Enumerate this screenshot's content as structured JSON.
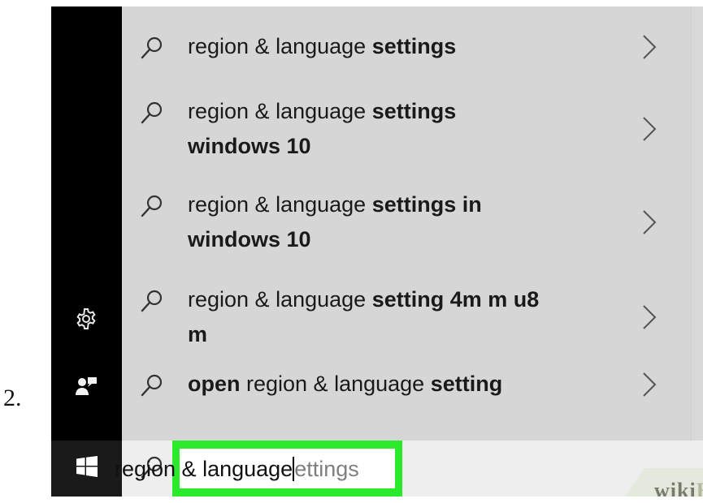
{
  "step_label": "2.",
  "sidebar": {
    "icons": [
      "gear-icon",
      "feedback-icon"
    ],
    "start_icon": "windows-start-icon"
  },
  "suggestions": [
    {
      "lines": [
        [
          {
            "t": "region & language ",
            "b": false
          },
          {
            "t": "settings",
            "b": true
          }
        ]
      ]
    },
    {
      "lines": [
        [
          {
            "t": "region & language ",
            "b": false
          },
          {
            "t": "settings",
            "b": true
          }
        ],
        [
          {
            "t": "windows 10",
            "b": true
          }
        ]
      ]
    },
    {
      "lines": [
        [
          {
            "t": "region & language ",
            "b": false
          },
          {
            "t": "settings in",
            "b": true
          }
        ],
        [
          {
            "t": "windows 10",
            "b": true
          }
        ]
      ]
    },
    {
      "lines": [
        [
          {
            "t": "region & language ",
            "b": false
          },
          {
            "t": "setting 4m m u8",
            "b": true
          }
        ],
        [
          {
            "t": "m",
            "b": true
          }
        ]
      ]
    },
    {
      "lines": [
        [
          {
            "t": "open",
            "b": true
          },
          {
            "t": " region & language ",
            "b": false
          },
          {
            "t": "setting",
            "b": true
          }
        ]
      ]
    }
  ],
  "search": {
    "typed": "region & language",
    "completion": "ettings",
    "icon": "search-icon",
    "highlight_color": "#2bea2b"
  },
  "watermark": {
    "part1": "wiki",
    "part2": "How"
  }
}
